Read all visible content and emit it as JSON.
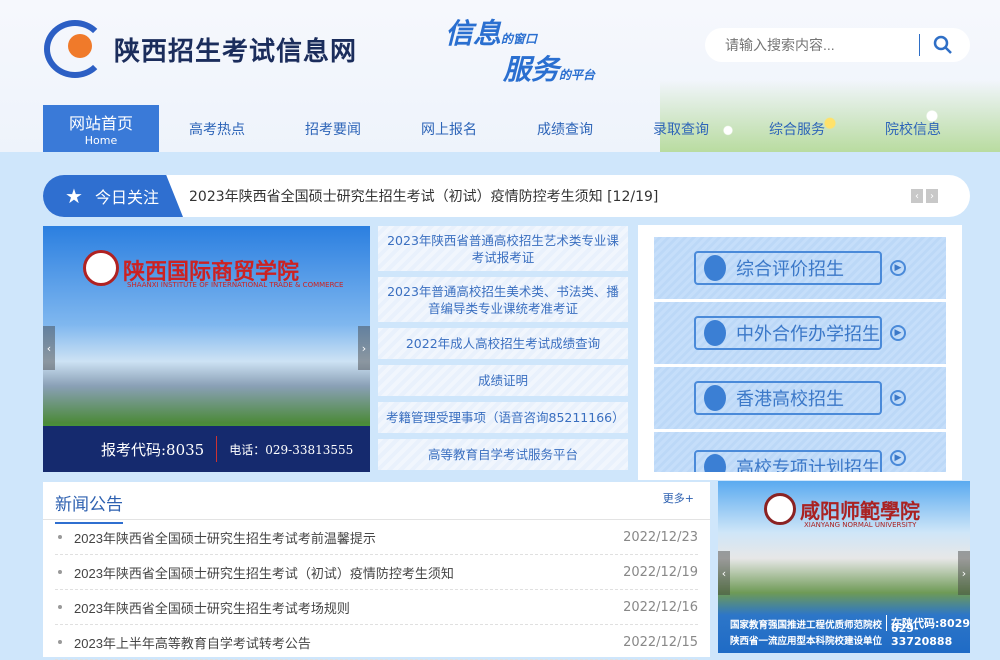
{
  "header": {
    "site_title": "陕西招生考试信息网",
    "slogan_line1": "信息",
    "slogan_line1_small": "的窗口",
    "slogan_line2": "服务",
    "slogan_line2_small": "的平台",
    "search_placeholder": "请输入搜索内容..."
  },
  "nav": [
    {
      "label": "网站首页",
      "sub": "Home"
    },
    {
      "label": "高考热点"
    },
    {
      "label": "招考要闻"
    },
    {
      "label": "网上报名"
    },
    {
      "label": "成绩查询"
    },
    {
      "label": "录取查询"
    },
    {
      "label": "综合服务"
    },
    {
      "label": "院校信息"
    }
  ],
  "focus": {
    "tag": "今日关注",
    "text": "2023年陕西省全国硕士研究生招生考试（初试）疫情防控考生须知 [12/19]",
    "prev": "‹",
    "next": "›"
  },
  "banner": {
    "school": "陕西国际商贸学院",
    "school_en": "SHAANXI INSTITUTE OF INTERNATIONAL TRADE & COMMERCE",
    "code": "报考代码:8035",
    "tel": "电话：029-33813555"
  },
  "quick_links": [
    "2023年陕西省普通高校招生艺术类专业课考试报考证",
    "2023年普通高校招生美术类、书法类、播音编导类专业课统考准考证",
    "2022年成人高校招生考试成绩查询",
    "成绩证明",
    "考籍管理受理事项（语音咨询85211166）",
    "高等教育自学考试服务平台"
  ],
  "services": [
    "综合评价招生",
    "中外合作办学招生",
    "香港高校招生",
    "高校专项计划招生"
  ],
  "news": {
    "title": "新闻公告",
    "more": "更多+",
    "items": [
      {
        "title": "2023年陕西省全国硕士研究生招生考试考前温馨提示",
        "date": "2022/12/23"
      },
      {
        "title": "2023年陕西省全国硕士研究生招生考试（初试）疫情防控考生须知",
        "date": "2022/12/19"
      },
      {
        "title": "2023年陕西省全国硕士研究生招生考试考场规则",
        "date": "2022/12/16"
      },
      {
        "title": "2023年上半年高等教育自学考试转考公告",
        "date": "2022/12/15"
      }
    ]
  },
  "ad": {
    "school": "咸阳师範學院",
    "school_en": "XIANYANG NORMAL UNIVERSITY",
    "line1": "国家教育强国推进工程优质师范院校",
    "line2": "陕西省一流应用型本科院校建设单位",
    "code": "在陕代码:8029",
    "tel": "029-33720888"
  }
}
